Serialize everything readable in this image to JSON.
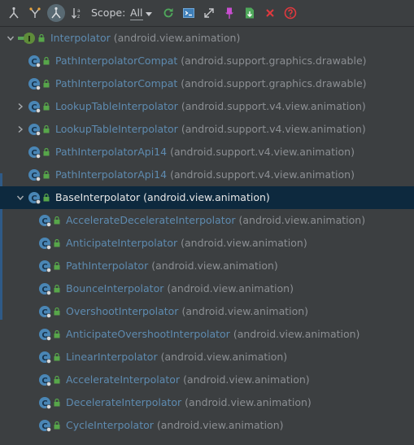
{
  "toolbar": {
    "scope_label": "Scope:",
    "scope_value": "All",
    "icons": [
      "subtypes-hierarchy-icon",
      "supertypes-hierarchy-icon",
      "class-hierarchy-icon",
      "sort-alphabetically-icon",
      "refresh-icon",
      "open-in-editor-icon",
      "expand-all-icon",
      "pin-icon",
      "export-icon",
      "close-icon",
      "help-icon"
    ]
  },
  "tree": {
    "root": {
      "name": "Interpolator",
      "package": "(android.view.animation)"
    },
    "items": [
      {
        "name": "PathInterpolatorCompat",
        "package": "(android.support.graphics.drawable)",
        "expandable": false
      },
      {
        "name": "PathInterpolatorCompat",
        "package": "(android.support.graphics.drawable)",
        "expandable": false
      },
      {
        "name": "LookupTableInterpolator",
        "package": "(android.support.v4.view.animation)",
        "expandable": true
      },
      {
        "name": "LookupTableInterpolator",
        "package": "(android.support.v4.view.animation)",
        "expandable": true
      },
      {
        "name": "PathInterpolatorApi14",
        "package": "(android.support.v4.view.animation)",
        "expandable": false
      },
      {
        "name": "PathInterpolatorApi14",
        "package": "(android.support.v4.view.animation)",
        "expandable": false
      }
    ],
    "selected": {
      "name": "BaseInterpolator",
      "package": "(android.view.animation)"
    },
    "children": [
      {
        "name": "AccelerateDecelerateInterpolator",
        "package": "(android.view.animation)"
      },
      {
        "name": "AnticipateInterpolator",
        "package": "(android.view.animation)"
      },
      {
        "name": "PathInterpolator",
        "package": "(android.view.animation)"
      },
      {
        "name": "BounceInterpolator",
        "package": "(android.view.animation)"
      },
      {
        "name": "OvershootInterpolator",
        "package": "(android.view.animation)"
      },
      {
        "name": "AnticipateOvershootInterpolator",
        "package": "(android.view.animation)"
      },
      {
        "name": "LinearInterpolator",
        "package": "(android.view.animation)"
      },
      {
        "name": "AccelerateInterpolator",
        "package": "(android.view.animation)"
      },
      {
        "name": "DecelerateInterpolator",
        "package": "(android.view.animation)"
      },
      {
        "name": "CycleInterpolator",
        "package": "(android.view.animation)"
      }
    ]
  },
  "colors": {
    "background": "#3c3f41",
    "selection": "#0d293e",
    "class_name": "#5e8bb0",
    "package": "#8c8f93",
    "class_icon": "#4a86b5",
    "interface_icon": "#5f8c3a",
    "lock_icon": "#57a64a"
  }
}
